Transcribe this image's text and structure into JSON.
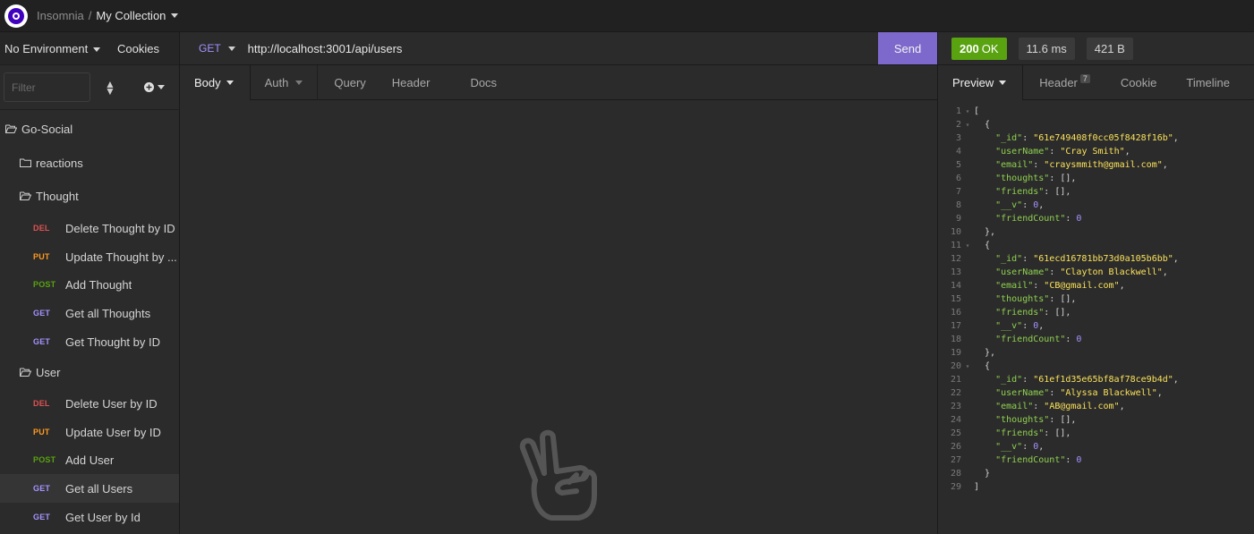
{
  "app": {
    "name": "Insomnia",
    "separator": "/",
    "collection": "My Collection"
  },
  "sidebar": {
    "environment": "No Environment",
    "cookies_label": "Cookies",
    "filter_placeholder": "Filter",
    "tree": [
      {
        "type": "workspace",
        "label": "Go-Social",
        "indent": 0
      },
      {
        "type": "folder",
        "label": "reactions",
        "indent": 1,
        "open": false
      },
      {
        "type": "folder",
        "label": "Thought",
        "indent": 1,
        "open": true
      },
      {
        "type": "request",
        "method": "DEL",
        "label": "Delete Thought by ID"
      },
      {
        "type": "request",
        "method": "PUT",
        "label": "Update Thought by ..."
      },
      {
        "type": "request",
        "method": "POST",
        "label": "Add Thought"
      },
      {
        "type": "request",
        "method": "GET",
        "label": "Get all Thoughts"
      },
      {
        "type": "request",
        "method": "GET",
        "label": "Get Thought by ID"
      },
      {
        "type": "folder",
        "label": "User",
        "indent": 1,
        "open": true
      },
      {
        "type": "request",
        "method": "DEL",
        "label": "Delete User by ID"
      },
      {
        "type": "request",
        "method": "PUT",
        "label": "Update User by ID"
      },
      {
        "type": "request",
        "method": "POST",
        "label": "Add User"
      },
      {
        "type": "request",
        "method": "GET",
        "label": "Get all Users",
        "selected": true
      },
      {
        "type": "request",
        "method": "GET",
        "label": "Get User by Id"
      }
    ]
  },
  "request": {
    "method": "GET",
    "url": "http://localhost:3001/api/users",
    "send_label": "Send",
    "tabs": [
      {
        "label": "Body",
        "active": true
      },
      {
        "label": "Auth"
      },
      {
        "label": "Query"
      },
      {
        "label": "Header"
      },
      {
        "label": "Docs"
      }
    ]
  },
  "response": {
    "status_code": "200",
    "status_text": "OK",
    "time": "11.6 ms",
    "size": "421 B",
    "tabs": [
      {
        "label": "Preview",
        "active": true
      },
      {
        "label": "Header",
        "count": "7"
      },
      {
        "label": "Cookie"
      },
      {
        "label": "Timeline"
      }
    ],
    "lines": [
      "[",
      "  {",
      "    \"_id\": \"61e749408f0cc05f8428f16b\",",
      "    \"userName\": \"Cray Smith\",",
      "    \"email\": \"craysmmith@gmail.com\",",
      "    \"thoughts\": [],",
      "    \"friends\": [],",
      "    \"__v\": 0,",
      "    \"friendCount\": 0",
      "  },",
      "  {",
      "    \"_id\": \"61ecd16781bb73d0a105b6bb\",",
      "    \"userName\": \"Clayton Blackwell\",",
      "    \"email\": \"CB@gmail.com\",",
      "    \"thoughts\": [],",
      "    \"friends\": [],",
      "    \"__v\": 0,",
      "    \"friendCount\": 0",
      "  },",
      "  {",
      "    \"_id\": \"61ef1d35e65bf8af78ce9b4d\",",
      "    \"userName\": \"Alyssa Blackwell\",",
      "    \"email\": \"AB@gmail.com\",",
      "    \"thoughts\": [],",
      "    \"friends\": [],",
      "    \"__v\": 0,",
      "    \"friendCount\": 0",
      "  }",
      "]"
    ]
  },
  "colors": {
    "accent": "#7d69cb",
    "ok": "#59a210",
    "del": "#e05252",
    "put": "#ff9a1f",
    "post": "#59a210",
    "get": "#a493ff"
  }
}
